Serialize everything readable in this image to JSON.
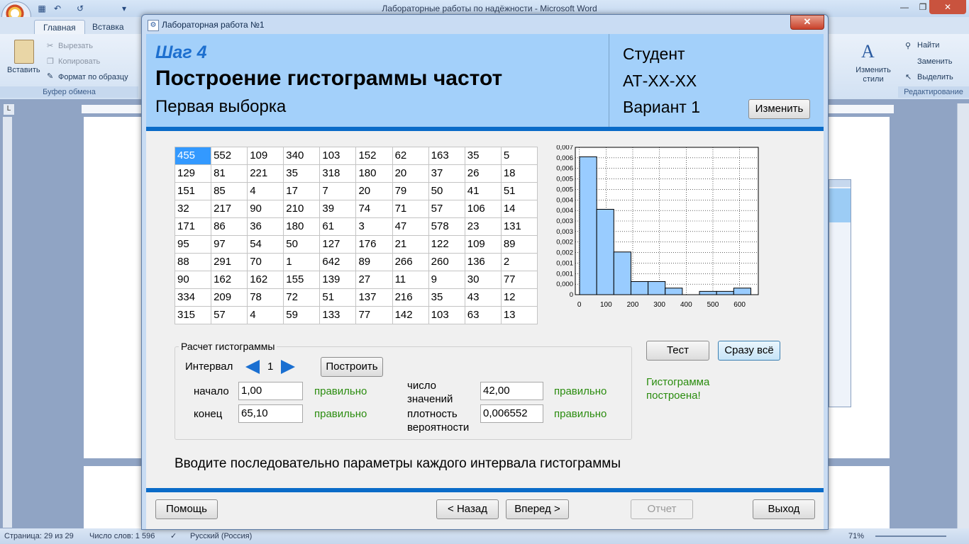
{
  "word": {
    "title": "Лабораторные работы по надёжности - Microsoft Word",
    "tabs": [
      "Главная",
      "Вставка"
    ],
    "clipboard": {
      "paste": "Вставить",
      "cut": "Вырезать",
      "copy": "Копировать",
      "format_painter": "Формат по образцу",
      "group": "Буфер обмена"
    },
    "styles_change": "Изменить стили",
    "editing": {
      "find": "Найти",
      "replace": "Заменить",
      "select": "Выделить",
      "group": "Редактирование"
    },
    "status": {
      "page": "Страница: 29 из 29",
      "words": "Число слов: 1 596",
      "language": "Русский (Россия)",
      "zoom": "71%"
    }
  },
  "dialog": {
    "title": "Лабораторная работа №1",
    "step": "Шаг 4",
    "heading": "Построение гистограммы частот",
    "subheading": "Первая выборка",
    "student": {
      "label": "Студент",
      "group": "АТ-XX-XX",
      "variant": "Вариант 1"
    },
    "change_button": "Изменить",
    "grid": [
      [
        "455",
        "552",
        "109",
        "340",
        "103",
        "152",
        "62",
        "163",
        "35",
        "5"
      ],
      [
        "129",
        "81",
        "221",
        "35",
        "318",
        "180",
        "20",
        "37",
        "26",
        "18"
      ],
      [
        "151",
        "85",
        "4",
        "17",
        "7",
        "20",
        "79",
        "50",
        "41",
        "51"
      ],
      [
        "32",
        "217",
        "90",
        "210",
        "39",
        "74",
        "71",
        "57",
        "106",
        "14"
      ],
      [
        "171",
        "86",
        "36",
        "180",
        "61",
        "3",
        "47",
        "578",
        "23",
        "131"
      ],
      [
        "95",
        "97",
        "54",
        "50",
        "127",
        "176",
        "21",
        "122",
        "109",
        "89"
      ],
      [
        "88",
        "291",
        "70",
        "1",
        "642",
        "89",
        "266",
        "260",
        "136",
        "2"
      ],
      [
        "90",
        "162",
        "162",
        "155",
        "139",
        "27",
        "11",
        "9",
        "30",
        "77"
      ],
      [
        "334",
        "209",
        "78",
        "72",
        "51",
        "137",
        "216",
        "35",
        "43",
        "12"
      ],
      [
        "315",
        "57",
        "4",
        "59",
        "133",
        "77",
        "142",
        "103",
        "63",
        "13"
      ]
    ],
    "calc": {
      "group_title": "Расчет гистограммы",
      "interval_label": "Интервал",
      "interval_value": "1",
      "build_button": "Построить",
      "start_label": "начало",
      "start_value": "1,00",
      "start_status": "правильно",
      "end_label": "конец",
      "end_value": "65,10",
      "end_status": "правильно",
      "count_label_1": "число",
      "count_label_2": "значений",
      "count_value": "42,00",
      "count_status": "правильно",
      "density_label_1": "плотность",
      "density_label_2": "вероятности",
      "density_value": "0,006552",
      "density_status": "правильно"
    },
    "test_button": "Тест",
    "all_button": "Сразу всё",
    "status_message": "Гистограмма построена!",
    "hint": "Вводите последовательно параметры каждого интервала гистограммы",
    "footer": {
      "help": "Помощь",
      "back": "< Назад",
      "next": "Вперед >",
      "report": "Отчет",
      "exit": "Выход"
    }
  },
  "chart_data": {
    "type": "bar",
    "x_ticks": [
      "0",
      "100",
      "200",
      "300",
      "400",
      "500",
      "600"
    ],
    "y_ticks": [
      "0",
      "0,000",
      "0,001",
      "0,001",
      "0,002",
      "0,002",
      "0,003",
      "0,003",
      "0,004",
      "0,004",
      "0,005",
      "0,005",
      "0,006",
      "0,006",
      "0,007"
    ],
    "xlim": [
      -15,
      670
    ],
    "ylim": [
      0,
      0.007
    ],
    "bin_width": 64.1,
    "bin_starts": [
      1,
      65.1,
      129.2,
      193.3,
      257.4,
      321.5,
      385.6,
      449.7,
      513.8,
      577.9
    ],
    "values": [
      0.006552,
      0.004056,
      0.002028,
      0.000624,
      0.000624,
      0.000312,
      0,
      0.000156,
      0.000156,
      0.000312
    ],
    "grid": true,
    "bar_color": "#99ccff"
  }
}
